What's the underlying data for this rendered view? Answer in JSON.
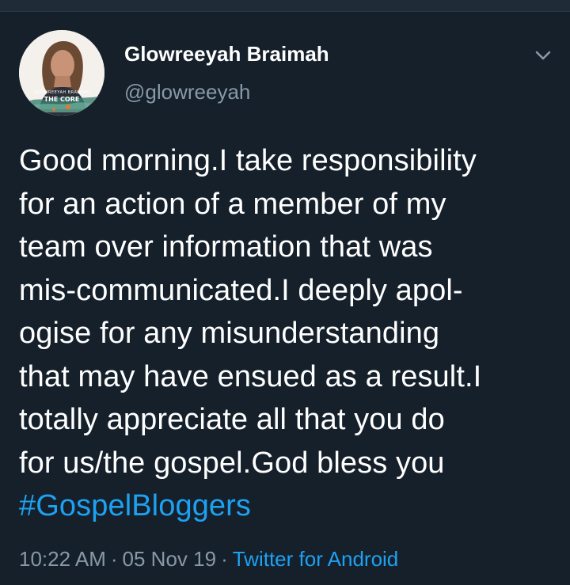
{
  "author": {
    "display_name": "Glowreeyah Braimah",
    "handle": "@glowreeyah",
    "avatar_icon": "profile-photo-avatar",
    "avatar_logo_text": "GLOWREEYAH BRAIMAH",
    "avatar_banner_text": "THE CORE"
  },
  "menu_icon": "chevron-down-icon",
  "tweet": {
    "lines": [
      "Good morning.I take responsibility",
      "for an action of a member of my",
      "team over information that was",
      "mis-communicated.I deeply apol-",
      "ogise for any misunderstanding",
      "that may have ensued as a result.I",
      "totally appreciate all that you do",
      "for us/the gospel.God bless you"
    ],
    "hashtag": "#GospelBloggers"
  },
  "meta": {
    "time": "10:22 AM",
    "separator": "·",
    "date": "05 Nov 19",
    "source": "Twitter for Android"
  },
  "colors": {
    "background": "#15202b",
    "text": "#ffffff",
    "secondary": "#8899a6",
    "link": "#1da1f2"
  }
}
